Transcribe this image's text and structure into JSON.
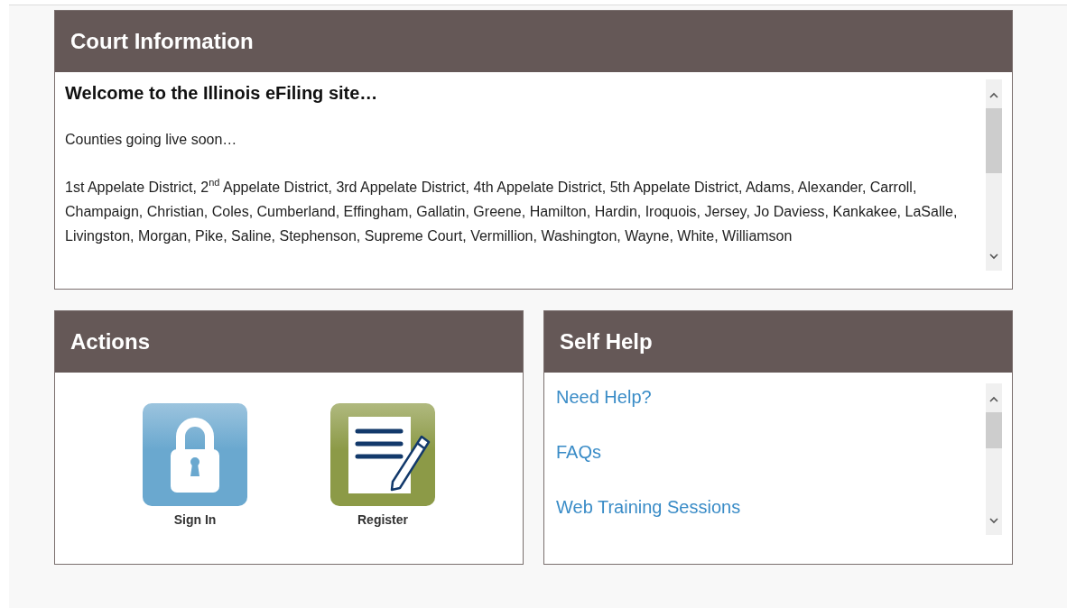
{
  "court_information": {
    "title": "Court Information",
    "heading": "Welcome to the Illinois eFiling site…",
    "subheading": "Counties going live soon…",
    "counties": "1st Appelate District, 2$^{nd}$ Appelate District, 3rd Appelate District, 4th Appelate District, 5th Appelate District, Adams, Alexander, Carroll, Champaign, Christian, Coles, Cumberland, Effingham, Gallatin, Greene, Hamilton, Hardin, Iroquois, Jersey, Jo Daviess, Kankakee, LaSalle, Livingston, Morgan, Pike, Saline, Stephenson, Supreme Court, Vermillion, Washington, Wayne, White, Williamson"
  },
  "actions": {
    "title": "Actions",
    "items": [
      {
        "kind": "lock",
        "label": "Sign In"
      },
      {
        "kind": "form",
        "label": "Register"
      }
    ]
  },
  "self_help": {
    "title": "Self Help",
    "links": [
      "Need Help?",
      "FAQs",
      "Web Training Sessions"
    ]
  }
}
